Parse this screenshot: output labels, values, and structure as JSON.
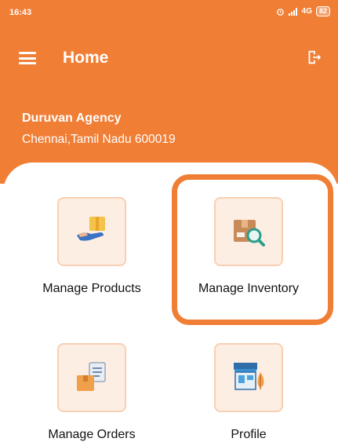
{
  "status_bar": {
    "time": "16:43",
    "network": "4G",
    "battery": "82"
  },
  "app_bar": {
    "title": "Home"
  },
  "agency": {
    "name": "Duruvan Agency",
    "address": "Chennai,Tamil Nadu 600019"
  },
  "menu": [
    {
      "label": "Manage Products",
      "icon": "hand-package-icon"
    },
    {
      "label": "Manage Inventory",
      "icon": "inventory-search-icon"
    },
    {
      "label": "Manage Orders",
      "icon": "orders-box-icon"
    },
    {
      "label": "Profile",
      "icon": "store-profile-icon"
    }
  ],
  "colors": {
    "primary": "#f07e35",
    "tile_background": "#fdeee4",
    "tile_border": "#f9cfb3"
  }
}
